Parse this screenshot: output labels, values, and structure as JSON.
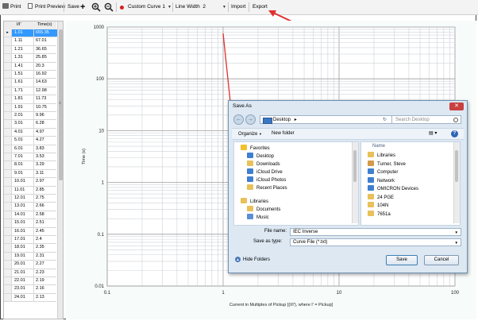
{
  "toolbar": {
    "print": "Print",
    "print_preview": "Print Preview",
    "save": "Save",
    "curve_select": "Custom Curve 1",
    "line_width_label": "Line Width",
    "line_width_value": "2",
    "import": "Import",
    "export": "Export",
    "icons": [
      "printer-icon",
      "print-preview-icon",
      "plus-icon",
      "zoom-in-icon",
      "zoom-out-icon",
      "red-dot-icon"
    ],
    "colors": {
      "toolbar_bg": "#f3f3f3",
      "annotation_arrow": "#e03030"
    }
  },
  "table": {
    "headers": [
      "I/I'",
      "Time(s)"
    ],
    "selected_row": 0,
    "rows": [
      [
        "1.01",
        "655.35"
      ],
      [
        "1.11",
        "67.01"
      ],
      [
        "1.21",
        "36.65"
      ],
      [
        "1.31",
        "25.85"
      ],
      [
        "1.41",
        "20.3"
      ],
      [
        "1.51",
        "16.92"
      ],
      [
        "1.61",
        "14.63"
      ],
      [
        "1.71",
        "12.98"
      ],
      [
        "1.81",
        "11.73"
      ],
      [
        "1.91",
        "10.75"
      ],
      [
        "2.01",
        "9.96"
      ],
      [
        "3.01",
        "6.28"
      ],
      [
        "4.01",
        "4.97"
      ],
      [
        "5.01",
        "4.27"
      ],
      [
        "6.01",
        "3.83"
      ],
      [
        "7.01",
        "3.53"
      ],
      [
        "8.01",
        "3.29"
      ],
      [
        "9.01",
        "3.11"
      ],
      [
        "10.01",
        "2.97"
      ],
      [
        "11.01",
        "2.85"
      ],
      [
        "12.01",
        "2.75"
      ],
      [
        "13.01",
        "2.66"
      ],
      [
        "14.01",
        "2.58"
      ],
      [
        "15.01",
        "2.51"
      ],
      [
        "16.01",
        "2.45"
      ],
      [
        "17.01",
        "2.4"
      ],
      [
        "18.01",
        "2.35"
      ],
      [
        "19.01",
        "2.31"
      ],
      [
        "20.01",
        "2.27"
      ],
      [
        "21.01",
        "2.23"
      ],
      [
        "22.01",
        "2.19"
      ],
      [
        "23.01",
        "2.16"
      ],
      [
        "24.01",
        "2.13"
      ]
    ]
  },
  "chart": {
    "ylabel": "Time (s)",
    "xlabel": "Current in Multiples of Pickup [(I/I'), where I' = Pickup]",
    "y_ticks": [
      "1000",
      "100",
      "10",
      "1",
      "0.1",
      "0.01"
    ],
    "x_ticks": [
      "0.1",
      "1",
      "10",
      "100"
    ]
  },
  "chart_data": {
    "type": "line",
    "x_scale": "log",
    "y_scale": "log",
    "xlim": [
      0.1,
      100
    ],
    "ylim": [
      0.01,
      1000
    ],
    "grid": true,
    "series": [],
    "xlabel": "Current in Multiples of Pickup [(I/I'), where I' = Pickup]",
    "ylabel": "Time (s)"
  },
  "dialog": {
    "title": "Save As",
    "close_glyph": "✕",
    "location": "Desktop",
    "location_chevron": "▸",
    "search_placeholder": "Search Desktop",
    "organize": "Organize",
    "new_folder": "New folder",
    "nav_back": "←",
    "nav_forward": "→",
    "nav_refresh": "↻",
    "nav_tree": [
      {
        "label": "Favorites",
        "icon": "star-icon"
      },
      {
        "label": "Desktop",
        "icon": "desktop-icon"
      },
      {
        "label": "Downloads",
        "icon": "downloads-icon"
      },
      {
        "label": "iCloud Drive",
        "icon": "cloud-icon"
      },
      {
        "label": "iCloud Photos",
        "icon": "cloud-icon"
      },
      {
        "label": "Recent Places",
        "icon": "recent-icon"
      },
      {
        "label": "Libraries",
        "icon": "library-icon"
      },
      {
        "label": "Documents",
        "icon": "documents-icon"
      },
      {
        "label": "Music",
        "icon": "music-icon"
      }
    ],
    "list_header": "Name",
    "list_items": [
      {
        "label": "Libraries",
        "icon": "library-icon"
      },
      {
        "label": "Turner, Steve",
        "icon": "user-icon"
      },
      {
        "label": "Computer",
        "icon": "computer-icon"
      },
      {
        "label": "Network",
        "icon": "network-icon"
      },
      {
        "label": "OMICRON Devices",
        "icon": "device-icon"
      },
      {
        "label": "24 PGE",
        "icon": "folder-icon"
      },
      {
        "label": "104N",
        "icon": "folder-icon"
      },
      {
        "label": "7651a",
        "icon": "folder-icon"
      }
    ],
    "file_name_label": "File name:",
    "file_name_value": "IEC Inverse",
    "save_type_label": "Save as type:",
    "save_type_value": "Curve File (*.txt)",
    "hide_folders": "Hide Folders",
    "save_button": "Save",
    "cancel_button": "Cancel",
    "colors": {
      "dialog_bg": "#dde8f3",
      "folder": "#e8c15a"
    }
  }
}
